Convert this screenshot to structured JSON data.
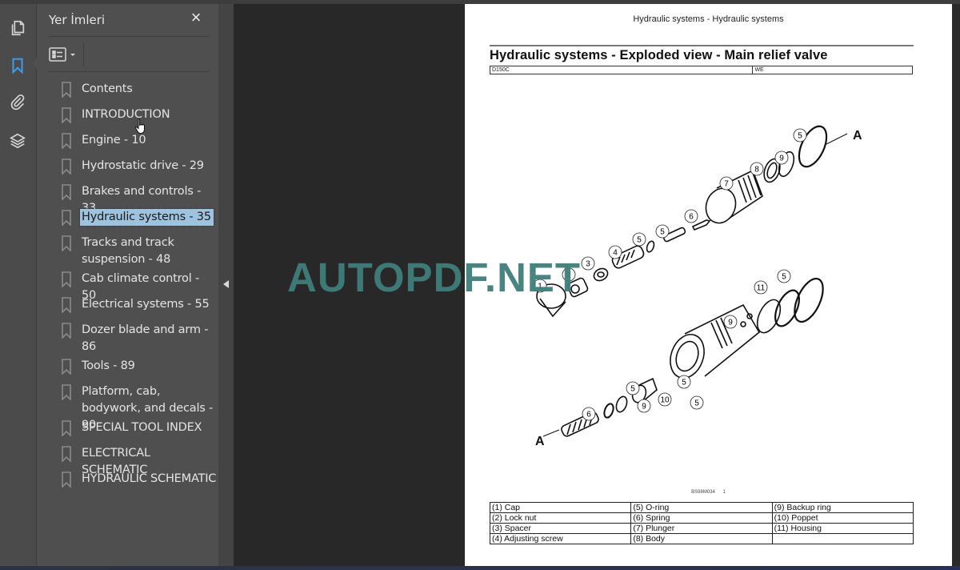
{
  "app": {
    "icon_rail": [
      {
        "name": "page-thumbnails",
        "icon": "pages-icon",
        "active": false
      },
      {
        "name": "bookmarks",
        "icon": "bookmark-icon",
        "active": true
      },
      {
        "name": "attachments",
        "icon": "paperclip-icon",
        "active": false
      },
      {
        "name": "layers",
        "icon": "layers-icon",
        "active": false
      }
    ],
    "accent": "#3d9be9"
  },
  "bookmarks_panel": {
    "title": "Yer İmleri",
    "close_icon": "×",
    "options_icon": "list-options-icon",
    "items": [
      {
        "label": "Contents",
        "selected": false
      },
      {
        "label": "INTRODUCTION",
        "selected": false
      },
      {
        "label": "Engine - 10",
        "selected": false
      },
      {
        "label": "Hydrostatic drive - 29",
        "selected": false
      },
      {
        "label": "Brakes and controls - 33",
        "selected": false
      },
      {
        "label": "Hydraulic systems - 35",
        "selected": true
      },
      {
        "label": "Tracks and track suspension - 48",
        "selected": false
      },
      {
        "label": "Cab climate control - 50",
        "selected": false
      },
      {
        "label": "Electrical systems - 55",
        "selected": false
      },
      {
        "label": "Dozer blade and arm - 86",
        "selected": false
      },
      {
        "label": "Tools - 89",
        "selected": false
      },
      {
        "label": "Platform, cab, bodywork, and decals - 90",
        "selected": false
      },
      {
        "label": "SPECIAL TOOL INDEX",
        "selected": false
      },
      {
        "label": "ELECTRICAL SCHEMATIC",
        "selected": false
      },
      {
        "label": "HYDRAULIC SCHEMATIC",
        "selected": false
      }
    ],
    "selected_color": "#9ec3de"
  },
  "document": {
    "running_head": "Hydraulic systems - Hydraulic systems",
    "title": "Hydraulic systems - Exploded view - Main relief valve",
    "meta": {
      "model": "D150C",
      "region": "WE"
    },
    "figure": {
      "caption_code": "BS98M034",
      "caption_number": "1",
      "callouts": [
        "1",
        "2",
        "3",
        "4",
        "5",
        "5",
        "6",
        "7",
        "8",
        "9",
        "5",
        "5",
        "11",
        "9",
        "5",
        "5",
        "10",
        "9",
        "5",
        "6"
      ],
      "section_markers": [
        "A",
        "A"
      ]
    },
    "parts": [
      [
        "(1) Cap",
        "(5) O-ring",
        "(9) Backup ring"
      ],
      [
        "(2) Lock nut",
        "(6) Spring",
        "(10) Poppet"
      ],
      [
        "(3) Spacer",
        "(7) Plunger",
        "(11) Housing"
      ],
      [
        "(4) Adjusting screw",
        "(8) Body",
        ""
      ]
    ]
  },
  "watermark": {
    "text": "AUTOPDF.NET",
    "color": "#3f7f7b"
  }
}
